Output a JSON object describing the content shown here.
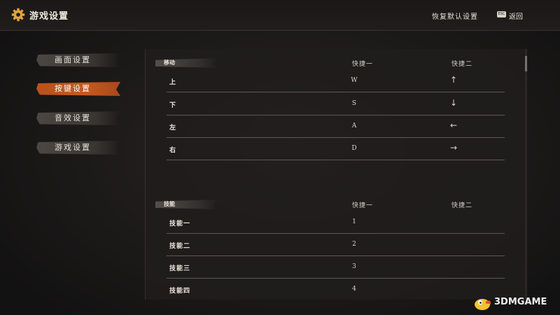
{
  "header": {
    "title": "游戏设置",
    "restore_label": "恢复默认设置",
    "esc_key": "ESC",
    "back_label": "返回"
  },
  "sidebar": {
    "items": [
      {
        "label": "画面设置",
        "active": false
      },
      {
        "label": "按键设置",
        "active": true
      },
      {
        "label": "音效设置",
        "active": false
      },
      {
        "label": "游戏设置",
        "active": false
      }
    ]
  },
  "sections": [
    {
      "title": "移动",
      "col1": "快捷一",
      "col2": "快捷二",
      "rows": [
        {
          "label": "上",
          "k1": "W",
          "k2": "↑"
        },
        {
          "label": "下",
          "k1": "S",
          "k2": "↓"
        },
        {
          "label": "左",
          "k1": "A",
          "k2": "←"
        },
        {
          "label": "右",
          "k1": "D",
          "k2": "→"
        }
      ]
    },
    {
      "title": "技能",
      "col1": "快捷一",
      "col2": "快捷二",
      "rows": [
        {
          "label": "技能一",
          "k1": "1",
          "k2": ""
        },
        {
          "label": "技能二",
          "k1": "2",
          "k2": ""
        },
        {
          "label": "技能三",
          "k1": "3",
          "k2": ""
        },
        {
          "label": "技能四",
          "k1": "4",
          "k2": ""
        }
      ]
    }
  ],
  "watermark": {
    "text": "3DMGAME"
  },
  "colors": {
    "accent": "#c45a1f",
    "background": "#1c1a19",
    "divider": "#605853"
  },
  "icons": [
    "gear-icon",
    "esc-key-icon",
    "watermark-logo-icon"
  ]
}
